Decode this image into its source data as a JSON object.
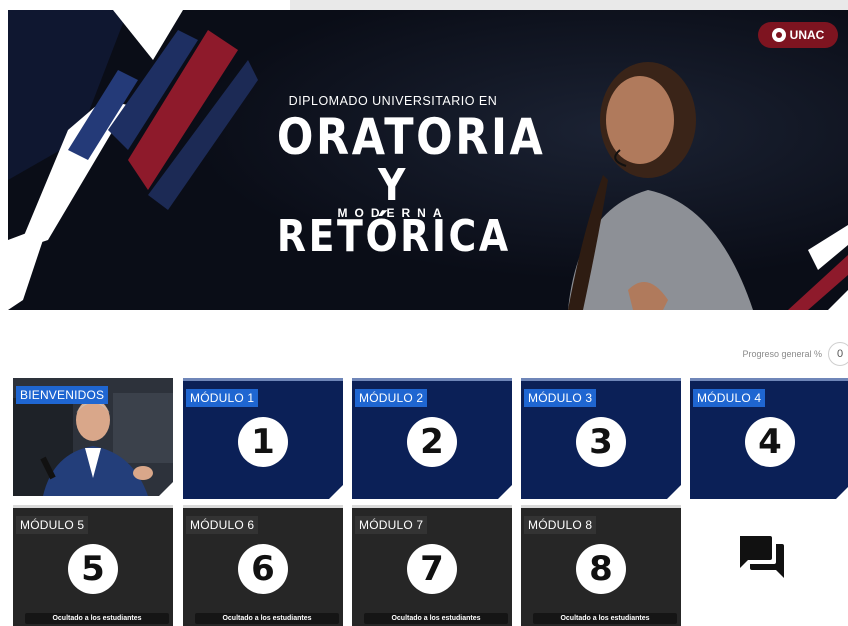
{
  "banner": {
    "kicker": "DIPLOMADO UNIVERSITARIO EN",
    "title_line1": "ORATORIA",
    "title_line2": "Y RETÓRICA",
    "subtitle": "MODERNA",
    "logo_text": "UNAC"
  },
  "progress": {
    "label": "Progreso general %",
    "value": "0"
  },
  "tiles": [
    {
      "label": "BIENVENIDOS"
    },
    {
      "label": "MÓDULO 1",
      "number": "1"
    },
    {
      "label": "MÓDULO 2",
      "number": "2"
    },
    {
      "label": "MÓDULO 3",
      "number": "3"
    },
    {
      "label": "MÓDULO 4",
      "number": "4"
    },
    {
      "label": "MÓDULO 5",
      "number": "5",
      "status": "Ocultado a los estudiantes"
    },
    {
      "label": "MÓDULO 6",
      "number": "6",
      "status": "Ocultado a los estudiantes"
    },
    {
      "label": "MÓDULO 7",
      "number": "7",
      "status": "Ocultado a los estudiantes"
    },
    {
      "label": "MÓDULO 8",
      "number": "8",
      "status": "Ocultado a los estudiantes"
    }
  ],
  "icons": {
    "chat": "forum-chat-icon"
  },
  "colors": {
    "banner_bg": "#0a0d17",
    "accent_red": "#8e1a2b",
    "module_blue": "#0b2057",
    "label_blue": "#1f66d1",
    "hidden_dark": "#262626"
  }
}
